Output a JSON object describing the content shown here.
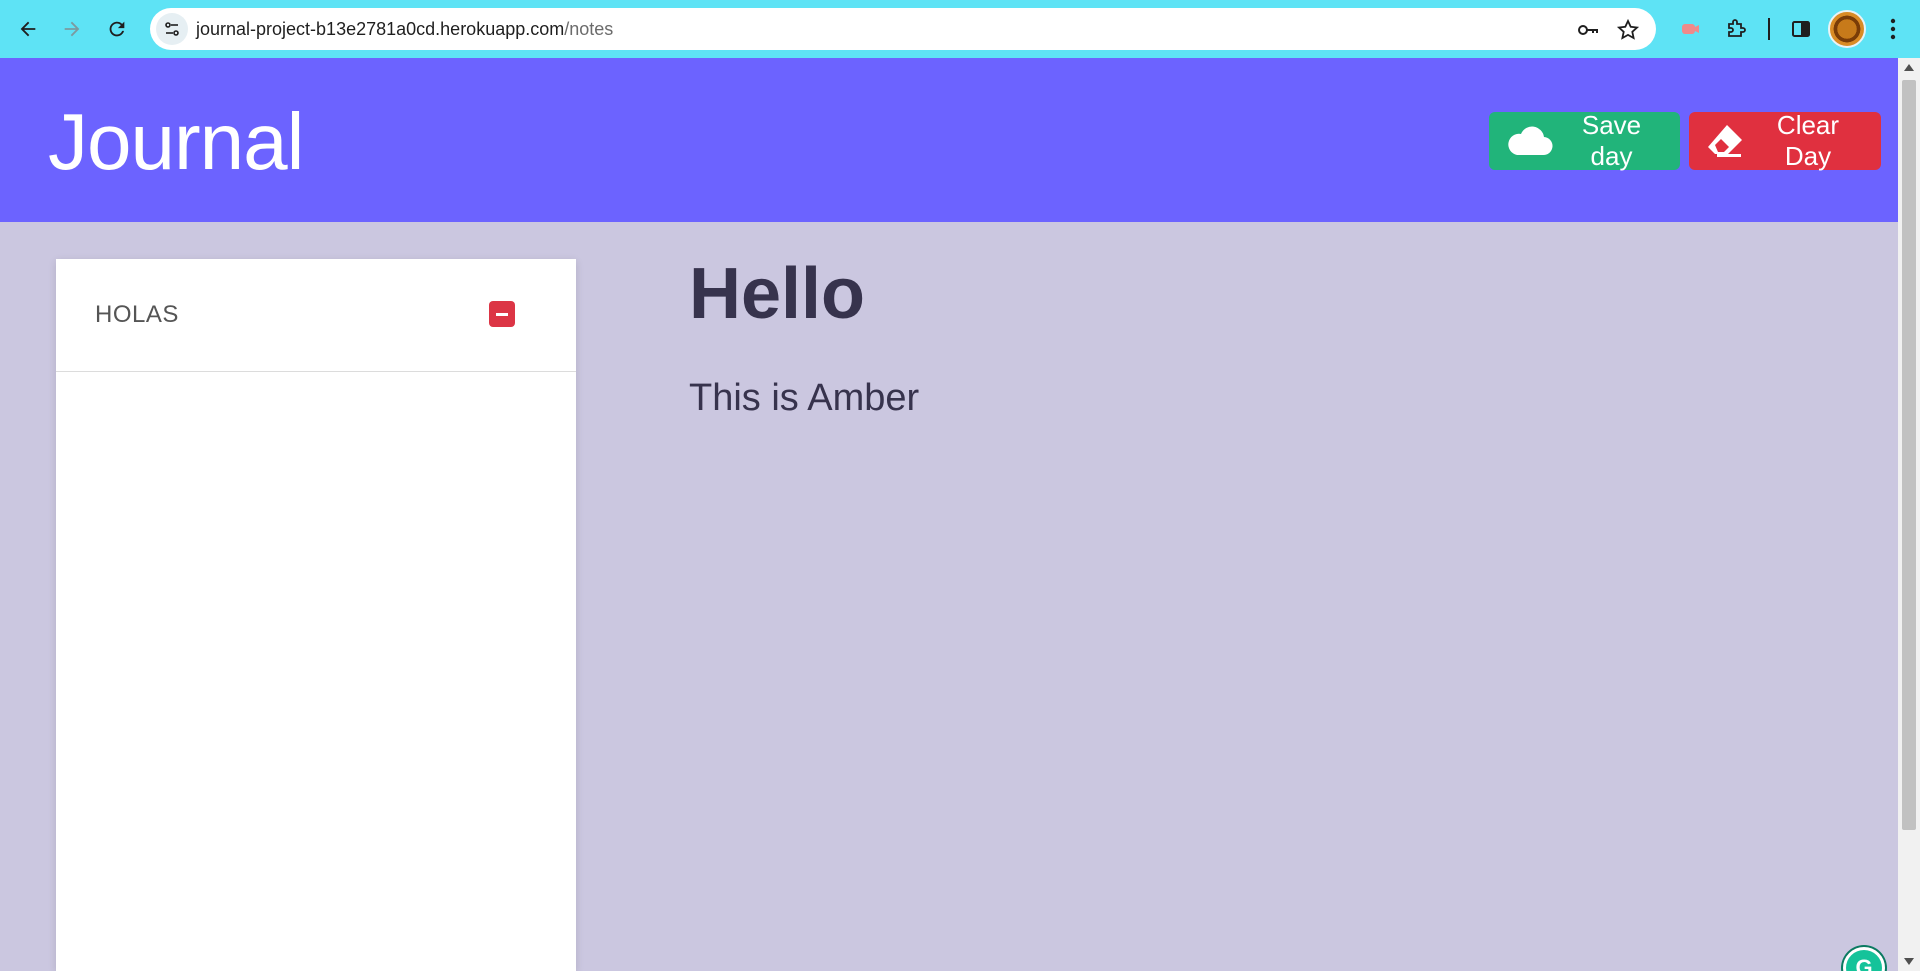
{
  "browser": {
    "url_host": "journal-project-b13e2781a0cd.herokuapp.com",
    "url_path": "/notes",
    "icons": [
      "back-arrow-icon",
      "forward-arrow-icon",
      "reload-icon",
      "site-info-icon",
      "key-icon",
      "star-icon",
      "extension-icon",
      "puzzle-icon",
      "sidepanel-icon",
      "menu-icon"
    ]
  },
  "app": {
    "title": "Journal",
    "save_label": "Save day",
    "clear_label": "Clear Day",
    "colors": {
      "header": "#6c63ff",
      "save": "#21b47a",
      "clear": "#e0303f",
      "background": "#cbc7e0"
    }
  },
  "sidebar": {
    "entries": [
      {
        "title": "HOLAS"
      }
    ]
  },
  "note": {
    "title": "Hello",
    "body": "This is Amber"
  },
  "grammarly": {
    "glyph": "G"
  }
}
